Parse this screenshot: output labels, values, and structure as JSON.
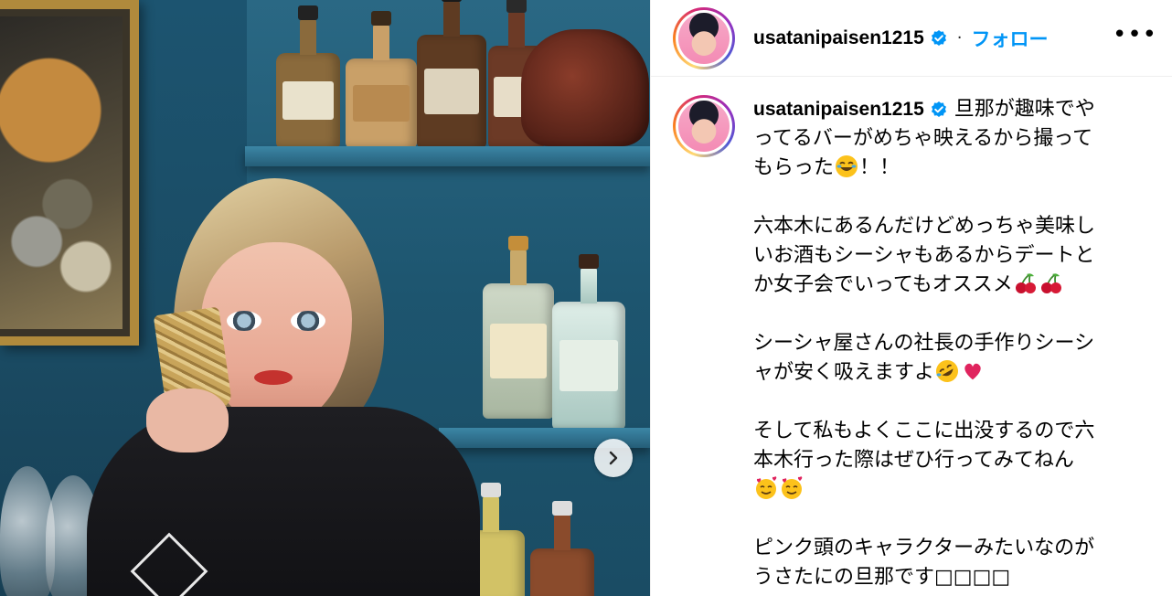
{
  "post": {
    "username": "usatanipaisen1215",
    "separator": "·",
    "follow_label": "フォロー",
    "more_label": "•••",
    "caption_lines": {
      "p1a": "旦那が趣味でや",
      "p1b": "ってるバーがめちゃ映えるから撮って",
      "p1c": "もらった",
      "p1c_tail": "！！",
      "p2a": "六本木にあるんだけどめっちゃ美味し",
      "p2b": "いお酒もシーシャもあるからデートと",
      "p2c": "か女子会でいってもオススメ",
      "p3a": "シーシャ屋さんの社長の手作りシーシ",
      "p3b": "ャが安く吸えますよ",
      "p4a": "そして私もよくここに出没するので六",
      "p4b": "本木行った際はぜひ行ってみてねん",
      "p5a": "ピンク頭のキャラクターみたいなのが",
      "p5b": "うさたにの旦那です",
      "p5_tail": "□□□□"
    }
  },
  "icons": {
    "verified": "verified-badge-icon",
    "next": "chevron-right-icon",
    "emojis": [
      "joy-emoji",
      "cherries-emoji",
      "rofl-emoji",
      "heart-emoji",
      "smiling-hearts-emoji"
    ]
  },
  "colors": {
    "follow": "#0095f6",
    "verified": "#0095f6",
    "wall": "#1d556f"
  }
}
